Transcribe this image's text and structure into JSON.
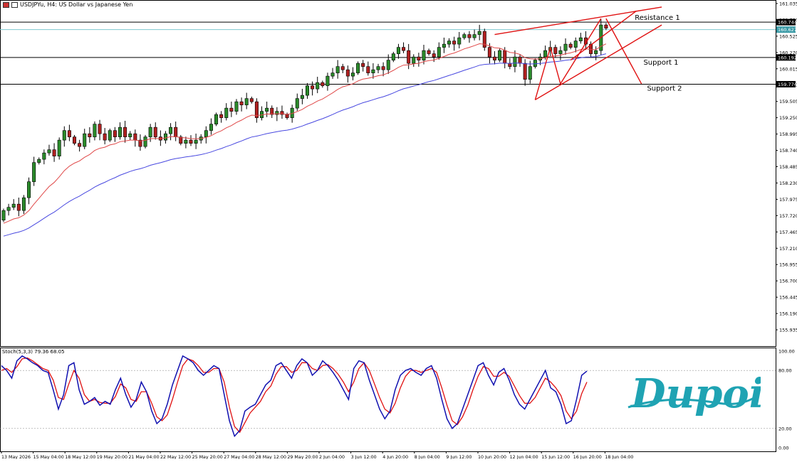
{
  "window": {
    "title": "USDJPYu, H4:  US Dollar vs Japanese Yen"
  },
  "indicator": {
    "label": "Stoch(5,3,3) 79.36 68.05",
    "levels": [
      "100.00",
      "80.00",
      "20.00",
      "0.00"
    ]
  },
  "annotations": {
    "resistance1": "Resistance 1",
    "support1": "Support 1",
    "support2": "Support 2"
  },
  "price_tags": {
    "resistance": "160.744",
    "current": "160.627",
    "support1": "160.192",
    "support2": "159.774"
  },
  "logo": {
    "text": "Dupoin",
    "color": "#1fa3b3"
  },
  "colors": {
    "up": "#2a8a2a",
    "down": "#b02020",
    "ma_fast": "#e04848",
    "ma_slow": "#4848e0",
    "stoch_main": "#1010b0",
    "stoch_signal": "#e01010",
    "trend": "#e01010",
    "current_line": "#7fc8d0"
  },
  "chart_data": {
    "type": "candlestick",
    "symbol": "USDJPYu",
    "timeframe": "H4",
    "ylim": [
      155.68,
      161.09
    ],
    "y_ticks": [
      "161.035",
      "160.780",
      "160.525",
      "160.270",
      "160.015",
      "159.760",
      "159.505",
      "159.250",
      "158.995",
      "158.740",
      "158.485",
      "158.230",
      "157.975",
      "157.720",
      "157.465",
      "157.210",
      "156.955",
      "156.700",
      "156.445",
      "156.190",
      "155.935"
    ],
    "x_labels": [
      "13 May 2026",
      "15 May 04:00",
      "18 May 12:00",
      "19 May 20:00",
      "21 May 04:00",
      "22 May 12:00",
      "25 May 20:00",
      "27 May 04:00",
      "28 May 12:00",
      "29 May 20:00",
      "2 Jun 04:00",
      "3 Jun 12:00",
      "4 Jun 20:00",
      "8 Jun 04:00",
      "9 Jun 12:00",
      "10 Jun 20:00",
      "12 Jun 04:00",
      "15 Jun 12:00",
      "16 Jun 20:00",
      "18 Jun 04:00"
    ],
    "closes": [
      157.8,
      157.85,
      157.9,
      157.8,
      158.0,
      158.25,
      158.55,
      158.6,
      158.7,
      158.75,
      158.65,
      158.9,
      159.05,
      158.95,
      158.85,
      158.8,
      159.0,
      158.95,
      159.15,
      159.0,
      158.9,
      159.05,
      158.95,
      159.1,
      158.95,
      159.0,
      158.9,
      158.8,
      158.95,
      159.1,
      158.95,
      158.9,
      159.0,
      159.1,
      158.95,
      158.85,
      158.9,
      158.85,
      158.9,
      158.95,
      159.05,
      159.15,
      159.3,
      159.25,
      159.4,
      159.35,
      159.5,
      159.45,
      159.55,
      159.5,
      159.25,
      159.35,
      159.4,
      159.3,
      159.35,
      159.3,
      159.25,
      159.4,
      159.55,
      159.6,
      159.75,
      159.7,
      159.8,
      159.75,
      159.9,
      159.95,
      160.05,
      160.0,
      159.9,
      159.95,
      160.1,
      160.05,
      159.95,
      160.0,
      160.05,
      160.0,
      160.15,
      160.25,
      160.35,
      160.3,
      160.1,
      160.2,
      160.15,
      160.3,
      160.25,
      160.2,
      160.35,
      160.4,
      160.45,
      160.4,
      160.5,
      160.55,
      160.5,
      160.55,
      160.6,
      160.35,
      160.2,
      160.15,
      160.3,
      160.1,
      160.05,
      160.2,
      160.1,
      159.85,
      160.05,
      160.15,
      160.2,
      160.3,
      160.35,
      160.25,
      160.3,
      160.4,
      160.35,
      160.45,
      160.5,
      160.4,
      160.25,
      160.3,
      160.7,
      160.65
    ],
    "series": [
      {
        "name": "Stoch",
        "values": [
          85,
          80,
          72,
          90,
          95,
          92,
          88,
          85,
          80,
          78,
          60,
          40,
          55,
          85,
          88,
          60,
          45,
          48,
          52,
          44,
          48,
          45,
          60,
          72,
          55,
          42,
          50,
          68,
          58,
          38,
          25,
          30,
          45,
          65,
          80,
          95,
          92,
          88,
          80,
          75,
          80,
          85,
          82,
          55,
          28,
          12,
          18,
          38,
          42,
          45,
          55,
          65,
          70,
          85,
          88,
          80,
          72,
          85,
          92,
          88,
          75,
          80,
          90,
          85,
          78,
          70,
          60,
          50,
          82,
          90,
          88,
          70,
          55,
          40,
          30,
          38,
          60,
          75,
          80,
          82,
          78,
          75,
          82,
          85,
          72,
          50,
          30,
          20,
          25,
          40,
          55,
          70,
          85,
          88,
          75,
          65,
          78,
          82,
          70,
          55,
          45,
          40,
          50,
          60,
          70,
          80,
          62,
          58,
          45,
          25,
          28,
          50,
          75,
          79.36
        ]
      },
      {
        "name": "Signal",
        "values": [
          80,
          82,
          78,
          84,
          92,
          93,
          90,
          86,
          82,
          80,
          70,
          52,
          50,
          66,
          80,
          72,
          55,
          48,
          50,
          47,
          46,
          46,
          53,
          66,
          62,
          50,
          48,
          58,
          58,
          46,
          32,
          28,
          34,
          50,
          68,
          85,
          92,
          90,
          85,
          78,
          78,
          82,
          82,
          68,
          42,
          22,
          16,
          26,
          36,
          42,
          48,
          58,
          64,
          76,
          84,
          84,
          78,
          80,
          88,
          88,
          82,
          80,
          85,
          86,
          82,
          76,
          68,
          58,
          68,
          82,
          88,
          80,
          66,
          52,
          40,
          36,
          46,
          62,
          74,
          80,
          80,
          78,
          80,
          82,
          78,
          62,
          44,
          28,
          24,
          32,
          44,
          60,
          74,
          84,
          82,
          74,
          74,
          78,
          74,
          64,
          54,
          46,
          46,
          52,
          62,
          72,
          68,
          62,
          54,
          38,
          30,
          38,
          56,
          68.05
        ]
      }
    ]
  }
}
